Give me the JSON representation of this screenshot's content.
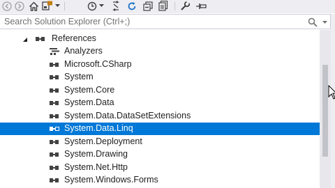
{
  "toolbar": {
    "buttons": [
      "back-icon",
      "forward-icon",
      "home-icon",
      "switch-views-icon",
      "history-icon",
      "sync-icon",
      "refresh-icon",
      "collapse-all-icon",
      "show-all-files-icon",
      "properties-icon",
      "pin-icon"
    ]
  },
  "search": {
    "placeholder": "Search Solution Explorer (Ctrl+;)"
  },
  "tree": {
    "parent": {
      "label": "References",
      "expanded": true
    },
    "items": [
      {
        "label": "Analyzers",
        "icon": "analyzers-icon",
        "selected": false
      },
      {
        "label": "Microsoft.CSharp",
        "icon": "reference-icon",
        "selected": false
      },
      {
        "label": "System",
        "icon": "reference-icon",
        "selected": false
      },
      {
        "label": "System.Core",
        "icon": "reference-icon",
        "selected": false
      },
      {
        "label": "System.Data",
        "icon": "reference-icon",
        "selected": false
      },
      {
        "label": "System.Data.DataSetExtensions",
        "icon": "reference-icon",
        "selected": false
      },
      {
        "label": "System.Data.Linq",
        "icon": "reference-icon",
        "selected": true
      },
      {
        "label": "System.Deployment",
        "icon": "reference-icon",
        "selected": false
      },
      {
        "label": "System.Drawing",
        "icon": "reference-icon",
        "selected": false
      },
      {
        "label": "System.Net.Http",
        "icon": "reference-icon",
        "selected": false
      },
      {
        "label": "System.Windows.Forms",
        "icon": "reference-icon",
        "selected": false
      }
    ]
  },
  "colors": {
    "selection": "#0078d7",
    "toolbar_bg": "#eeeef2",
    "reference_icon": "#424242"
  }
}
